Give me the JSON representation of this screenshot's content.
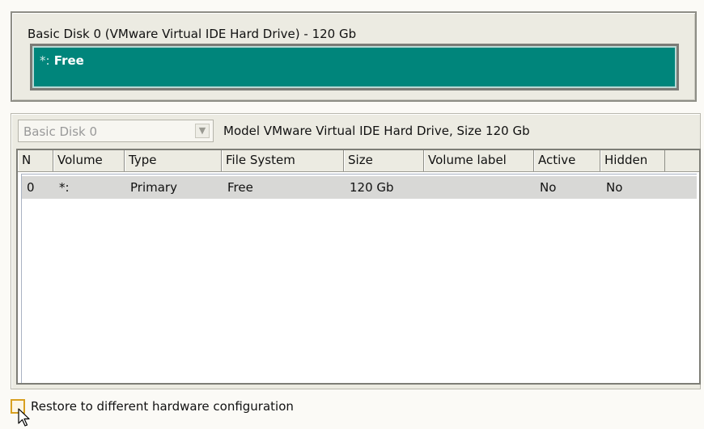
{
  "disk_map": {
    "title": "Basic Disk 0 (VMware Virtual IDE Hard Drive) - 120 Gb",
    "partition": {
      "letter": "*:",
      "label": "Free",
      "color": "#00857b"
    }
  },
  "disk_select": {
    "value": "Basic Disk 0"
  },
  "model_info": "Model VMware Virtual IDE Hard Drive, Size 120 Gb",
  "table": {
    "columns": [
      "N",
      "Volume",
      "Type",
      "File System",
      "Size",
      "Volume label",
      "Active",
      "Hidden"
    ],
    "rows": [
      {
        "n": "0",
        "volume": "*:",
        "type": "Primary",
        "file_system": "Free",
        "size": "120 Gb",
        "volume_label": "",
        "active": "No",
        "hidden": "No"
      }
    ]
  },
  "restore_checkbox": {
    "label": "Restore to different hardware configuration",
    "checked": false
  }
}
